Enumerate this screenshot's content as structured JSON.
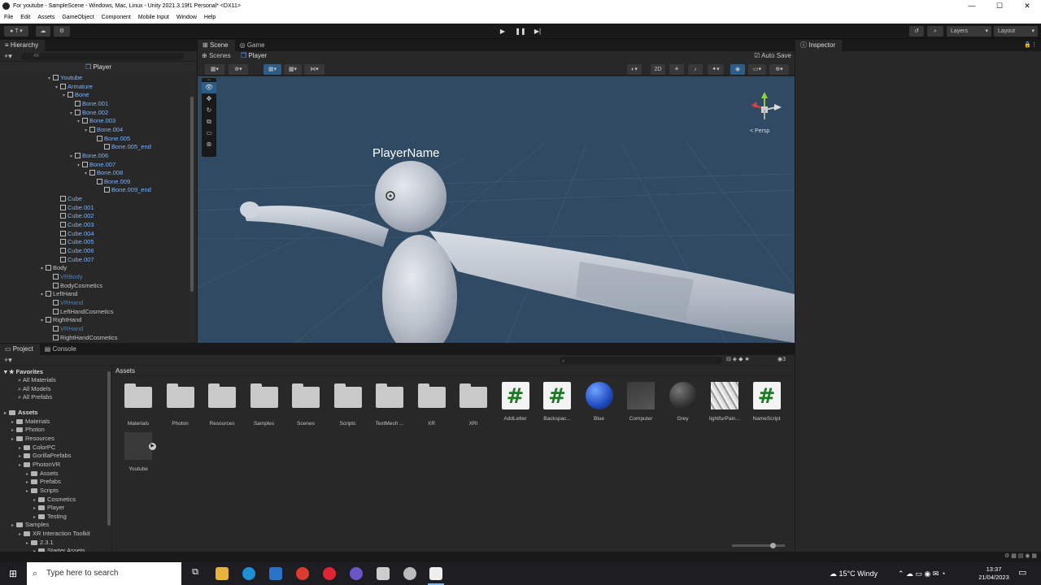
{
  "window": {
    "title": "For youtube - SampleScene - Windows, Mac, Linux - Unity 2021.3.19f1 Personal* <DX11>",
    "minimize": "—",
    "maximize": "☐",
    "close": "✕"
  },
  "menu": [
    "File",
    "Edit",
    "Assets",
    "GameObject",
    "Component",
    "Mobile Input",
    "Window",
    "Help"
  ],
  "toolbar": {
    "account": "T",
    "layers": "Layers",
    "layout": "Layout"
  },
  "hierarchy": {
    "tab": "Hierarchy",
    "search_placeholder": "All",
    "breadcrumb": "Player",
    "rows": [
      {
        "label": "Youtube",
        "depth": 1
      },
      {
        "label": "Armature",
        "depth": 2
      },
      {
        "label": "Bone",
        "depth": 3
      },
      {
        "label": "Bone.001",
        "depth": 4
      },
      {
        "label": "Bone.002",
        "depth": 4
      },
      {
        "label": "Bone.003",
        "depth": 5
      },
      {
        "label": "Bone.004",
        "depth": 6
      },
      {
        "label": "Bone.005",
        "depth": 7
      },
      {
        "label": "Bone.005_end",
        "depth": 8
      },
      {
        "label": "Bone.006",
        "depth": 4
      },
      {
        "label": "Bone.007",
        "depth": 5
      },
      {
        "label": "Bone.008",
        "depth": 6
      },
      {
        "label": "Bone.009",
        "depth": 7
      },
      {
        "label": "Bone.009_end",
        "depth": 8
      },
      {
        "label": "Cube",
        "depth": 2
      },
      {
        "label": "Cube.001",
        "depth": 2
      },
      {
        "label": "Cube.002",
        "depth": 2
      },
      {
        "label": "Cube.003",
        "depth": 2
      },
      {
        "label": "Cube.004",
        "depth": 2
      },
      {
        "label": "Cube.005",
        "depth": 2
      },
      {
        "label": "Cube.006",
        "depth": 2
      },
      {
        "label": "Cube.007",
        "depth": 2
      },
      {
        "label": "Body",
        "depth": 0
      },
      {
        "label": "VRBody",
        "depth": 1
      },
      {
        "label": "BodyCosmetics",
        "depth": 1
      },
      {
        "label": "LeftHand",
        "depth": 0
      },
      {
        "label": "VRHand",
        "depth": 1
      },
      {
        "label": "LeftHandCosmetics",
        "depth": 1
      },
      {
        "label": "RightHand",
        "depth": 0
      },
      {
        "label": "VRHand",
        "depth": 1
      },
      {
        "label": "RightHandCosmetics",
        "depth": 1
      }
    ]
  },
  "scene": {
    "tabs": [
      "Scene",
      "Game"
    ],
    "breadcrumb_root": "Scenes",
    "breadcrumb_item": "Player",
    "autosave": "Auto Save",
    "mode_2d": "2D",
    "persp": "< Persp",
    "player_name": "PlayerName"
  },
  "inspector": {
    "tab": "Inspector"
  },
  "project": {
    "tabs": [
      "Project",
      "Console"
    ],
    "favorites": "Favorites",
    "fav_items": [
      "All Materials",
      "All Models",
      "All Prefabs"
    ],
    "tree": [
      {
        "label": "Assets",
        "depth": 0
      },
      {
        "label": "Materials",
        "depth": 1
      },
      {
        "label": "Photon",
        "depth": 1
      },
      {
        "label": "Resources",
        "depth": 1
      },
      {
        "label": "ColorPC",
        "depth": 2
      },
      {
        "label": "GorillaPrefabs",
        "depth": 2
      },
      {
        "label": "PhotonVR",
        "depth": 2
      },
      {
        "label": "Assets",
        "depth": 3
      },
      {
        "label": "Prefabs",
        "depth": 3
      },
      {
        "label": "Scripts",
        "depth": 3
      },
      {
        "label": "Cosmetics",
        "depth": 4
      },
      {
        "label": "Player",
        "depth": 4
      },
      {
        "label": "Testing",
        "depth": 4
      },
      {
        "label": "Samples",
        "depth": 1
      },
      {
        "label": "XR Interaction Toolkit",
        "depth": 2
      },
      {
        "label": "2.3.1",
        "depth": 3
      },
      {
        "label": "Starter Assets",
        "depth": 4
      }
    ],
    "path": "Assets",
    "count": "3",
    "assets": [
      {
        "label": "Materials",
        "kind": "folder"
      },
      {
        "label": "Photon",
        "kind": "folder"
      },
      {
        "label": "Resources",
        "kind": "folder"
      },
      {
        "label": "Samples",
        "kind": "folder"
      },
      {
        "label": "Scenes",
        "kind": "folder"
      },
      {
        "label": "Scripts",
        "kind": "folder"
      },
      {
        "label": "TextMesh ...",
        "kind": "folder"
      },
      {
        "label": "XR",
        "kind": "folder"
      },
      {
        "label": "XRI",
        "kind": "folder"
      },
      {
        "label": "AddLetter",
        "kind": "script"
      },
      {
        "label": "Backspac...",
        "kind": "script"
      },
      {
        "label": "Blue",
        "kind": "material-blue"
      },
      {
        "label": "Computer",
        "kind": "model"
      },
      {
        "label": "Grey",
        "kind": "material-grey"
      },
      {
        "label": "lightfurPain...",
        "kind": "texture"
      },
      {
        "label": "NameScript",
        "kind": "script"
      },
      {
        "label": "Youtube",
        "kind": "prefab"
      }
    ],
    "script_glyph": "#"
  },
  "taskbar": {
    "search_placeholder": "Type here to search",
    "weather": "15°C  Windy",
    "time": "13:37",
    "date": "21/04/2023"
  },
  "colors": {
    "accent": "#2c5d87",
    "scene_bg": "#2f4a62",
    "text_blue": "#7bb3ff"
  }
}
